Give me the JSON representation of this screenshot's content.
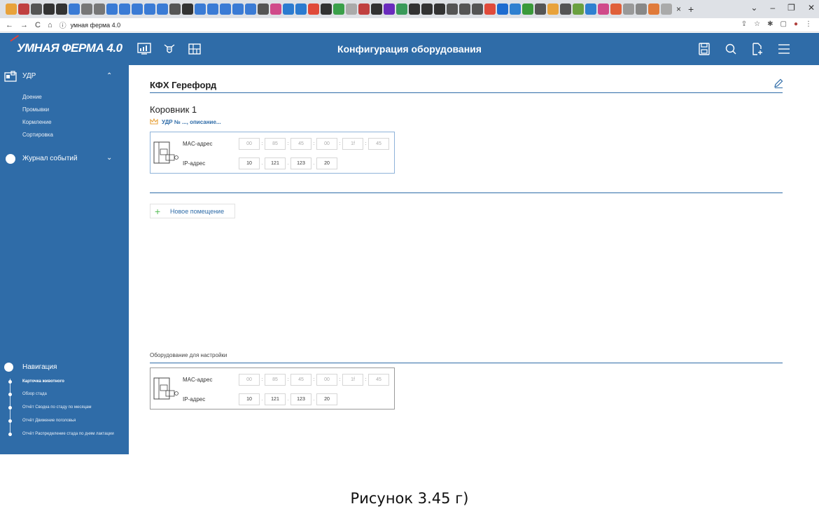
{
  "browser": {
    "tab_favicons": [
      "#e8a23b",
      "#c04040",
      "#555",
      "#333",
      "#333",
      "#3a7bd5",
      "#777",
      "#777",
      "#3a7bd5",
      "#3a7bd5",
      "#3a7bd5",
      "#3a7bd5",
      "#3a7bd5",
      "#555",
      "#333",
      "#3a7bd5",
      "#3a7bd5",
      "#3a7bd5",
      "#3a7bd5",
      "#3a7bd5",
      "#555",
      "#d04a8a",
      "#2b7bd0",
      "#2b7bd0",
      "#e04a3a",
      "#333",
      "#3aa04a",
      "#aaa",
      "#c04040",
      "#333",
      "#6a2bbd",
      "#3a9a5a",
      "#333",
      "#333",
      "#333",
      "#555",
      "#555",
      "#555",
      "#e04a3a",
      "#1e6cd0",
      "#2f80d0",
      "#3a9a3a",
      "#555",
      "#e8a23b",
      "#555",
      "#6aa040",
      "#2f80d0",
      "#d04a8a",
      "#e0603a",
      "#999",
      "#888",
      "#e07a3a",
      "#aaa"
    ],
    "tab_close": "×",
    "new_tab": "+",
    "win_min": "–",
    "win_restore": "❐",
    "win_close": "✕",
    "win_chevron": "⌄",
    "back": "←",
    "forward": "→",
    "reload": "C",
    "home": "⌂",
    "info": "ⓘ",
    "url": "умная ферма 4.0",
    "right_icons": [
      "⇪",
      "☆",
      "✱",
      "▢",
      "●",
      "⋮"
    ]
  },
  "header": {
    "logo": "Умная ферма 4.0",
    "title": "Конфигурация оборудования"
  },
  "sidebar": {
    "udr_label": "УДР",
    "udr_sub": [
      "Доение",
      "Промывки",
      "Кормление",
      "Сортировка"
    ],
    "journal_label": "Журнал событий",
    "nav_label": "Навигация",
    "nav_links": [
      "Карточка животного",
      "Обзор стада",
      "Отчёт Сводка по стаду по месяцам",
      "Отчёт Движение поголовья",
      "Отчёт Распределение стада по дням лактации"
    ]
  },
  "main": {
    "farm_title": "КФХ Герефорд",
    "room_title": "Коровник 1",
    "udr_text": "УДР № ..., описание...",
    "add_room_label": "Новое помещение",
    "equipment_label": "Оборудование для настройки",
    "card": {
      "mac_label": "MAC-адрес",
      "ip_label": "IP-адрес",
      "mac": [
        "00",
        "85",
        "45",
        "00",
        "1f",
        "45"
      ],
      "ip": [
        "10",
        "121",
        "123",
        "20"
      ]
    }
  },
  "caption": "Рисунок 3.45 г)"
}
